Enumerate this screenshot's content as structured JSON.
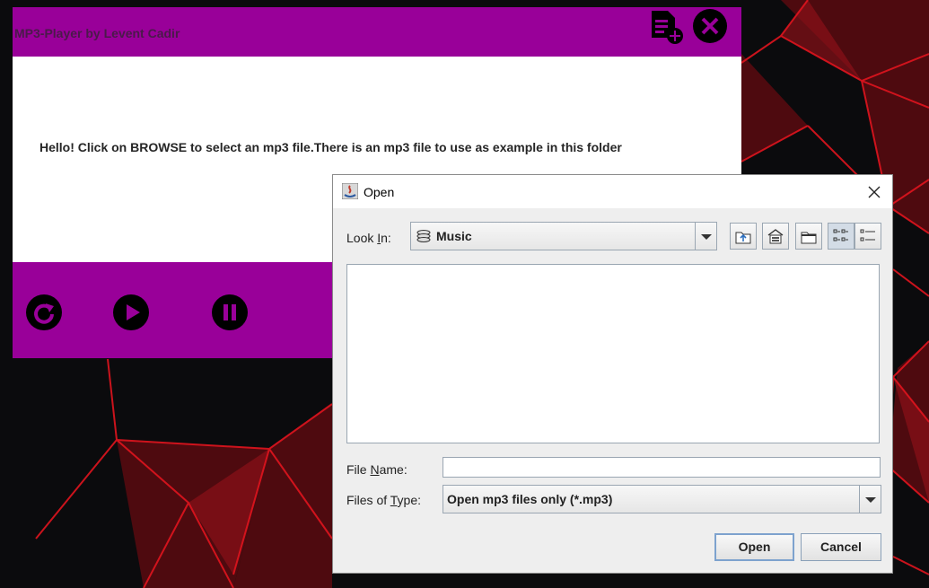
{
  "player": {
    "title": "MP3-Player by Levent Cadir",
    "message": "Hello! Click on BROWSE to select an mp3 file.There is an mp3 file to use as example in this folder",
    "header_icons": [
      "add-file-icon",
      "close-icon"
    ],
    "control_icons": [
      "replay-icon",
      "play-icon",
      "pause-icon"
    ],
    "accent_color": "#990099"
  },
  "dialog": {
    "title": "Open",
    "look_in_label_pre": "Look ",
    "look_in_label_mnemonic": "I",
    "look_in_label_post": "n:",
    "look_in_value": "Music",
    "toolbar_icons": [
      "up-one-level-icon",
      "home-icon",
      "new-folder-icon",
      "list-view-icon",
      "details-view-icon"
    ],
    "file_name_label_pre": "File ",
    "file_name_label_mnemonic": "N",
    "file_name_label_post": "ame:",
    "file_name_value": "",
    "files_of_type_label_pre": "Files of ",
    "files_of_type_label_mnemonic": "T",
    "files_of_type_label_post": "ype:",
    "files_of_type_value": "Open mp3 files only (*.mp3)",
    "open_button": "Open",
    "cancel_button": "Cancel"
  }
}
